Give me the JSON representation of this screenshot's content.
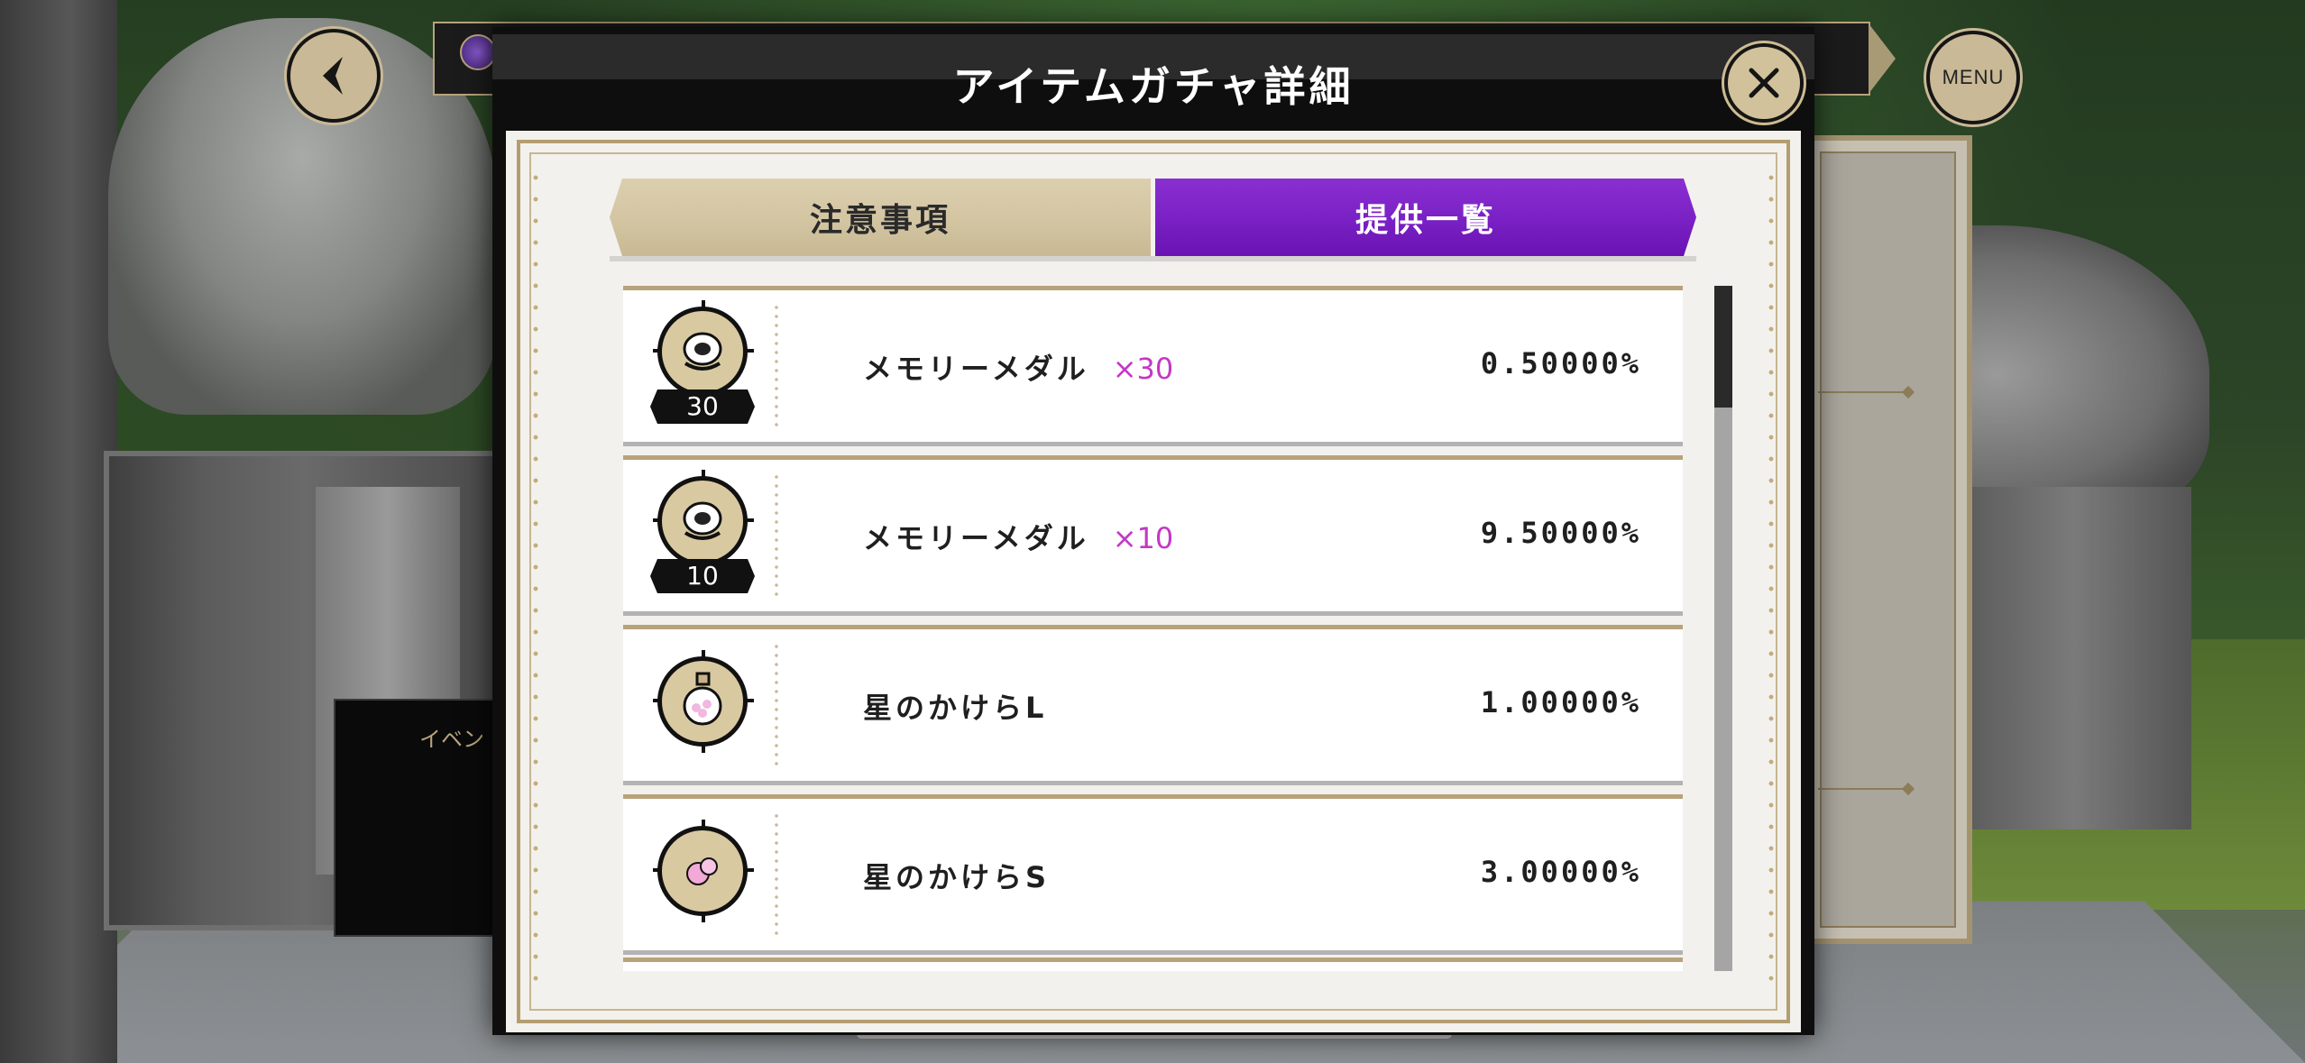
{
  "modal": {
    "title": "アイテムガチャ詳細",
    "close_icon": "close-icon"
  },
  "tabs": [
    {
      "label": "注意事項",
      "active": false
    },
    {
      "label": "提供一覧",
      "active": true
    }
  ],
  "items": [
    {
      "name": "メモリーメダル",
      "quantity": "×30",
      "rate": "0.50000%",
      "badge": "30",
      "icon": "memory-medal-icon"
    },
    {
      "name": "メモリーメダル",
      "quantity": "×10",
      "rate": "9.50000%",
      "badge": "10",
      "icon": "memory-medal-icon"
    },
    {
      "name": "星のかけらL",
      "quantity": "",
      "rate": "1.00000%",
      "badge": "",
      "icon": "star-fragment-bottle-icon"
    },
    {
      "name": "星のかけらS",
      "quantity": "",
      "rate": "3.00000%",
      "badge": "",
      "icon": "star-fragment-small-icon"
    }
  ],
  "hud": {
    "menu_label": "MENU",
    "event_label": "イベン"
  },
  "colors": {
    "accent_purple": "#7b22c6",
    "quantity_magenta": "#c338c5",
    "gold_frame": "#b39e72"
  }
}
